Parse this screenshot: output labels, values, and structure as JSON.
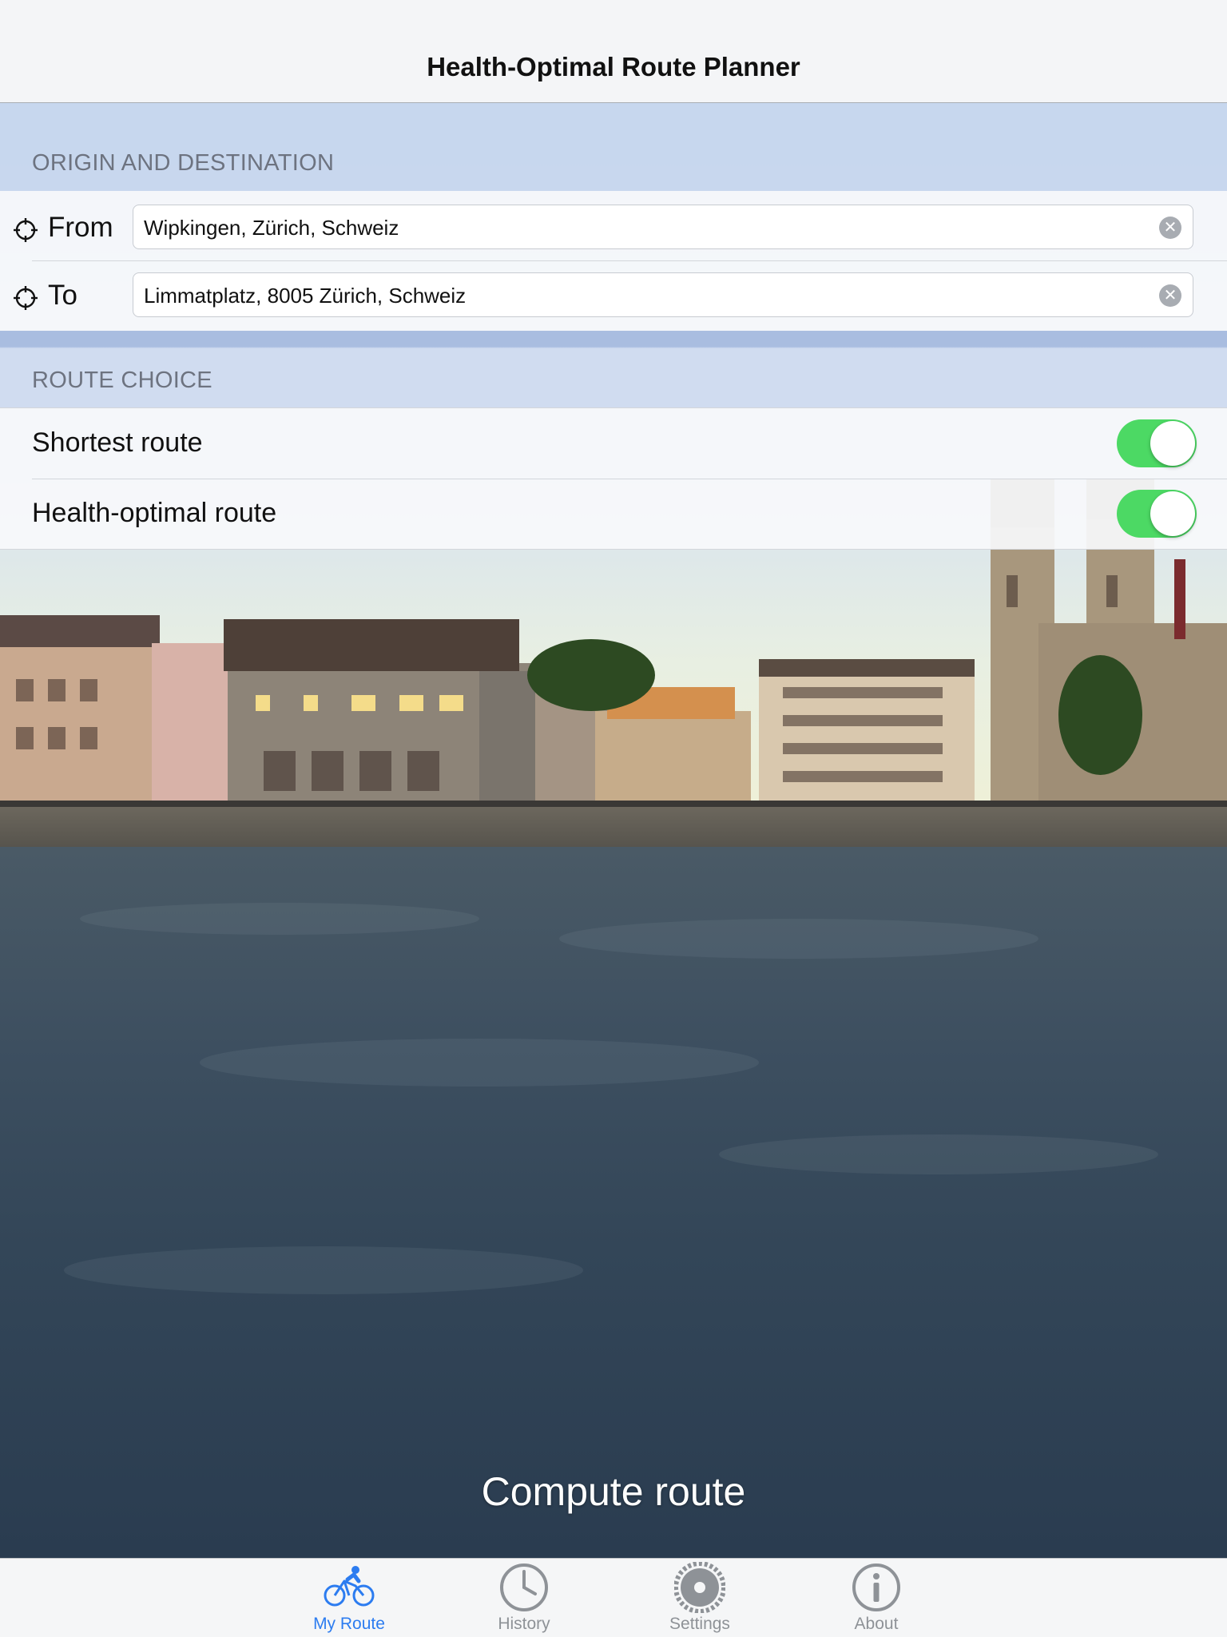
{
  "nav": {
    "title": "Health-Optimal Route Planner"
  },
  "origin_destination": {
    "header": "ORIGIN AND DESTINATION",
    "from": {
      "label": "From",
      "value": "Wipkingen, Zürich, Schweiz"
    },
    "to": {
      "label": "To",
      "value": "Limmatplatz, 8005 Zürich, Schweiz"
    }
  },
  "route_choice": {
    "header": "ROUTE CHOICE",
    "options": [
      {
        "label": "Shortest route",
        "enabled": true
      },
      {
        "label": "Health-optimal route",
        "enabled": true
      }
    ]
  },
  "compute_button": "Compute route",
  "tabs": [
    {
      "label": "My Route",
      "icon": "bicycle-icon",
      "active": true
    },
    {
      "label": "History",
      "icon": "clock-icon",
      "active": false
    },
    {
      "label": "Settings",
      "icon": "gear-icon",
      "active": false
    },
    {
      "label": "About",
      "icon": "info-icon",
      "active": false
    }
  ],
  "colors": {
    "accent": "#2c7cf0",
    "toggle_on": "#4cd964"
  }
}
